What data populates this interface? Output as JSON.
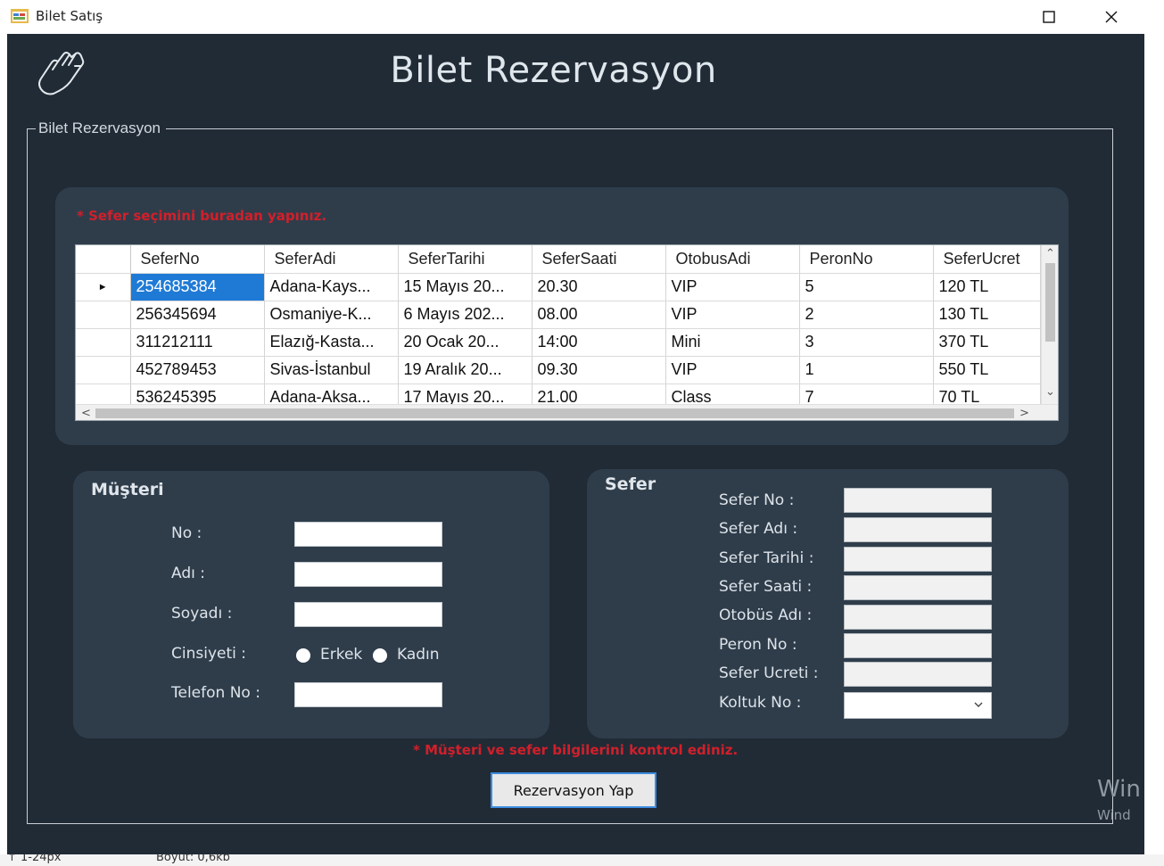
{
  "window": {
    "title": "Bilet Satış",
    "app_icon": "app-form-icon",
    "maximize_icon": "maximize-icon",
    "close_icon": "close-icon"
  },
  "header": {
    "title": "Bilet Rezervasyon",
    "icon": "hand-pointer-icon"
  },
  "groupbox": {
    "legend": "Bilet Rezervasyon"
  },
  "grid_panel": {
    "note": "* Sefer seçimini buradan yapınız."
  },
  "grid": {
    "columns": [
      "SeferNo",
      "SeferAdi",
      "SeferTarihi",
      "SeferSaati",
      "OtobusAdi",
      "PeronNo",
      "SeferUcret"
    ],
    "rows": [
      [
        "254685384",
        "Adana-Kays...",
        "15 Mayıs 20...",
        "20.30",
        "VIP",
        "5",
        "120 TL"
      ],
      [
        "256345694",
        "Osmaniye-K...",
        "6 Mayıs 202...",
        "08.00",
        "VIP",
        "2",
        "130 TL"
      ],
      [
        "311212111",
        "Elazığ-Kasta...",
        "20 Ocak 20...",
        "14:00",
        "Mini",
        "3",
        "370 TL"
      ],
      [
        "452789453",
        "Sivas-İstanbul",
        "19 Aralık 20...",
        "09.30",
        "VIP",
        "1",
        "550 TL"
      ],
      [
        "536245395",
        "Adana-Aksa...",
        "17 Mayıs 20...",
        "21.00",
        "Class",
        "7",
        "70 TL"
      ]
    ],
    "selected_row": 0,
    "current_row_marker": "►",
    "scroll_up": "⌃",
    "scroll_down": "⌄",
    "scroll_left": "<",
    "scroll_right": ">"
  },
  "musteri": {
    "title": "Müşteri",
    "labels": {
      "no": "No :",
      "adi": "Adı :",
      "soyadi": "Soyadı :",
      "cinsiyeti": "Cinsiyeti :",
      "telefon": "Telefon No :"
    },
    "values": {
      "no": "",
      "adi": "",
      "soyadi": "",
      "telefon": ""
    },
    "gender_options": [
      "Erkek",
      "Kadın"
    ]
  },
  "sefer": {
    "title": "Sefer",
    "labels": {
      "sefer_no": "Sefer No :",
      "sefer_adi": "Sefer Adı :",
      "sefer_tarihi": "Sefer Tarihi :",
      "sefer_saati": "Sefer Saati :",
      "otobus_adi": "Otobüs Adı :",
      "peron_no": "Peron No :",
      "sefer_ucreti": "Sefer Ucreti :",
      "koltuk_no": "Koltuk No :"
    },
    "koltuk_selected": ""
  },
  "bottom_note": "* Müşteri ve sefer bilgilerini kontrol ediniz.",
  "submit_button": "Rezervasyon Yap",
  "watermark": {
    "line1": "Win",
    "line2": "Wind"
  },
  "status_strip": {
    "left": "↑ 1-24px",
    "right": "Boyut: 0,6kb"
  },
  "colors": {
    "form_bg": "#212b36",
    "panel_bg": "#2f3d4b",
    "accent_red": "#d21f2a",
    "selection_blue": "#1f7ad6",
    "button_border": "#3c8de0"
  }
}
